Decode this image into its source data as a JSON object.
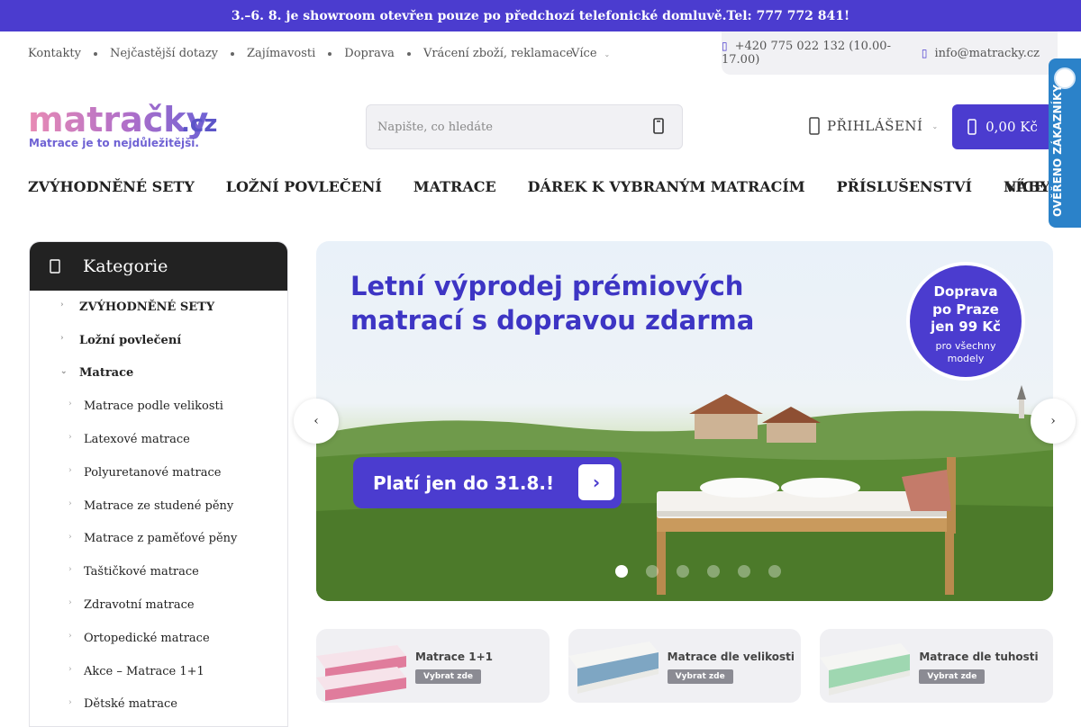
{
  "announcement": "3.–6. 8. je showroom otevřen pouze po předchozí telefonické domluvě.Tel: 777 772 841!",
  "util_nav": [
    "Kontakty",
    "Nejčastější dotazy",
    "Zajímavosti",
    "Doprava",
    "Vrácení zboží, reklamace"
  ],
  "util_more": "Více",
  "contact": {
    "phone": "+420 775 022 132 (10.00-17.00)",
    "email": "info@matracky.cz"
  },
  "logo": {
    "brand": "matračky",
    "tld": ".cz",
    "tagline": "Matrace je to nejdůležitější."
  },
  "search": {
    "placeholder": "Napište, co hledáte"
  },
  "login": "PŘIHLÁŠENÍ",
  "cart": "0,00 Kč",
  "main_nav": [
    "ZVÝHODNĚNÉ SETY",
    "LOŽNÍ POVLEČENÍ",
    "MATRACE",
    "DÁREK K VYBRANÝM MATRACÍM",
    "PŘÍSLUŠENSTVÍ",
    "NÁBYTEK"
  ],
  "main_nav_more": "VÍCE",
  "badge": "OVĚŘENO ZÁKAZNÍKY",
  "sidebar": {
    "title": "Kategorie",
    "items": [
      {
        "label": "ZVÝHODNĚNÉ SETY",
        "level": 1
      },
      {
        "label": "Ložní povlečení",
        "level": 1
      },
      {
        "label": "Matrace",
        "level": 1
      },
      {
        "label": "Matrace podle velikosti",
        "level": 2
      },
      {
        "label": "Latexové matrace",
        "level": 2
      },
      {
        "label": "Polyuretanové matrace",
        "level": 2
      },
      {
        "label": "Matrace ze studené pěny",
        "level": 2
      },
      {
        "label": "Matrace z paměťové pěny",
        "level": 2
      },
      {
        "label": "Taštičkové matrace",
        "level": 2
      },
      {
        "label": "Zdravotní matrace",
        "level": 2
      },
      {
        "label": "Ortopedické matrace",
        "level": 2
      },
      {
        "label": "Akce – Matrace 1+1",
        "level": 2
      },
      {
        "label": "Dětské matrace",
        "level": 2
      }
    ]
  },
  "banner": {
    "headline_1": "Letní výprodej prémiových",
    "headline_2": "matrací s dopravou zdarma",
    "cta": "Platí jen do 31.8.!",
    "circle_1": "Doprava",
    "circle_2": "po Praze",
    "circle_3": "jen 99 Kč",
    "circle_4": "pro všechny",
    "circle_5": "modely",
    "slide_count": 6,
    "active_slide": 1
  },
  "tiles": [
    {
      "title": "Matrace 1+1",
      "button": "Vybrat zde"
    },
    {
      "title": "Matrace dle velikosti",
      "button": "Vybrat zde"
    },
    {
      "title": "Matrace dle tuhosti",
      "button": "Vybrat zde"
    }
  ],
  "colors": {
    "brand": "#4b3ccf",
    "badge": "#2b82c9",
    "dark": "#222222"
  }
}
